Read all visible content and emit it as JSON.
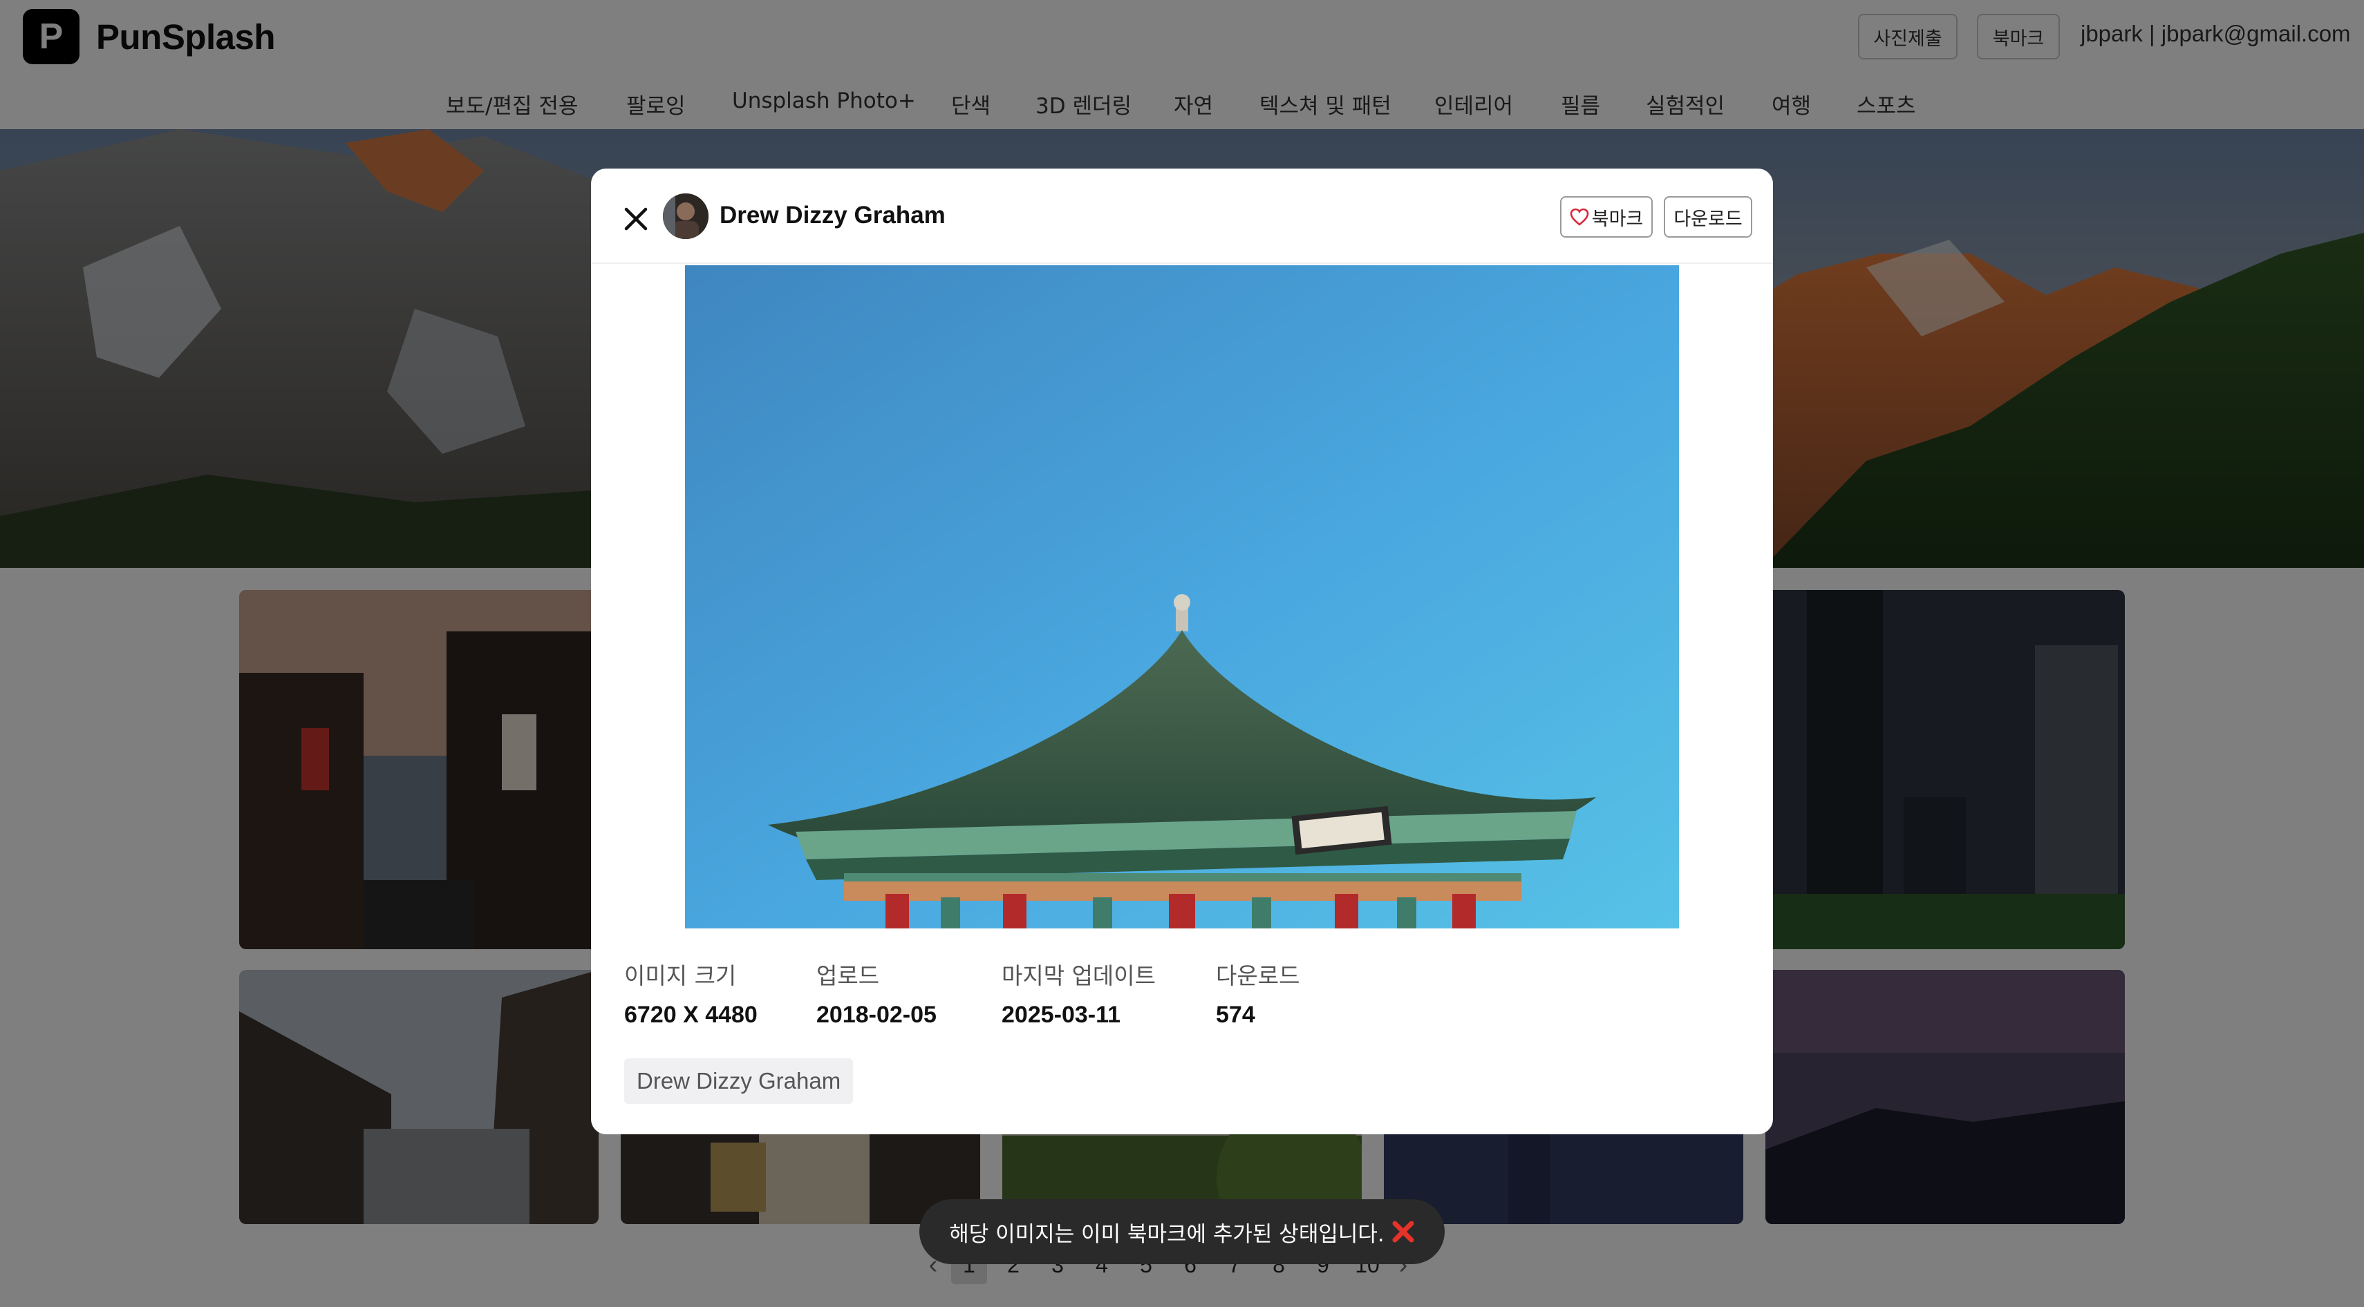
{
  "app": {
    "logo_letter": "P",
    "name": "PunSplash"
  },
  "header": {
    "submit_photo": "사진제출",
    "bookmark": "북마크",
    "user": "jbpark | jbpark@gmail.com"
  },
  "nav": {
    "items": [
      "보도/편집 전용",
      "팔로잉",
      "Unsplash Photo+",
      "단색",
      "3D 렌더링",
      "자연",
      "텍스쳐 및 패턴",
      "인테리어",
      "필름",
      "실험적인",
      "여행",
      "스포츠"
    ]
  },
  "modal": {
    "author": "Drew Dizzy Graham",
    "bookmark_button": "북마크",
    "download_button": "다운로드",
    "image_icon": "pavilion-photo",
    "stats": [
      {
        "label": "이미지 크기",
        "value": "6720 X 4480"
      },
      {
        "label": "업로드",
        "value": "2018-02-05"
      },
      {
        "label": "마지막 업데이트",
        "value": "2025-03-11"
      },
      {
        "label": "다운로드",
        "value": "574"
      }
    ],
    "tag": "Drew Dizzy Graham"
  },
  "pagination": {
    "prev": "‹",
    "pages": [
      "1",
      "2",
      "3",
      "4",
      "5",
      "6",
      "7",
      "8",
      "9",
      "10"
    ],
    "current": "1",
    "next": "›"
  },
  "toast": {
    "message": "해당 이미지는 이미 북마크에 추가된 상태입니다.",
    "icon": "close-x-icon",
    "icon_color": "#e5332a"
  },
  "colors": {
    "accent_heart": "#d8283a",
    "overlay": "rgba(0,0,0,0.5)"
  }
}
